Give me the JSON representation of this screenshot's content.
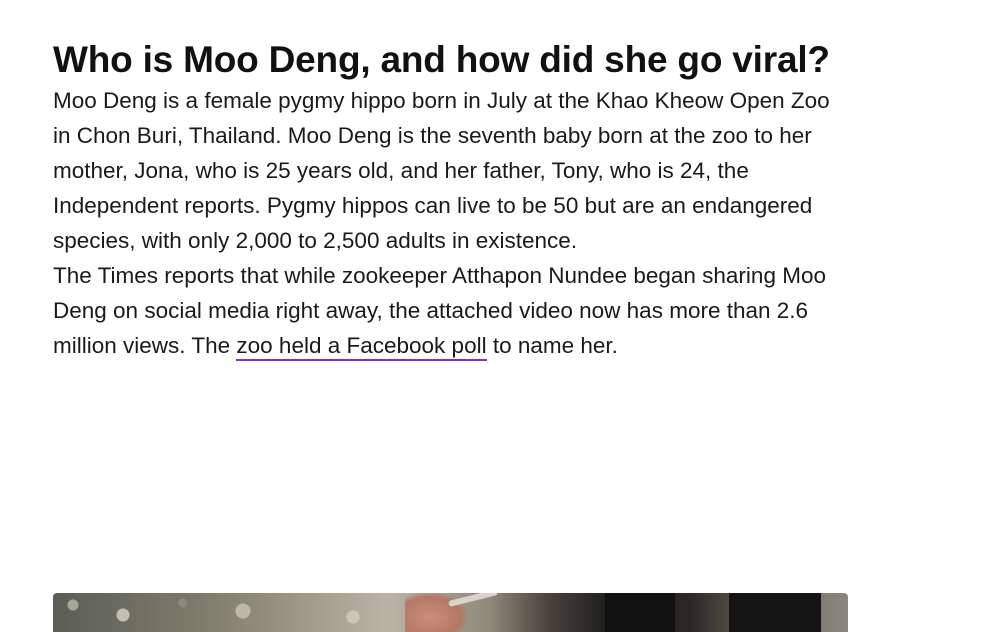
{
  "article": {
    "headline": "Who is Moo Deng, and how did she go viral?",
    "paragraph_1": "Moo Deng is a female pygmy hippo born in July at the Khao Kheow Open Zoo in Chon Buri, Thailand. Moo Deng is the seventh baby born at the zoo to her mother, Jona, who is 25 years old, and her father, Tony, who is 24, the Independent reports. Pygmy hippos can live to be 50 but are an endangered species, with only 2,000 to 2,500 adults in existence.",
    "paragraph_2": {
      "before_link": "The Times reports that while zookeeper Atthapon Nundee began sharing Moo Deng on social media right away, the attached video now has more than 2.6 million views. The ",
      "link_text": "zoo held a Facebook poll",
      "after_link": " to name her."
    }
  },
  "colors": {
    "text": "#111111",
    "link_underline": "#7b2fd8",
    "background": "#ffffff"
  }
}
